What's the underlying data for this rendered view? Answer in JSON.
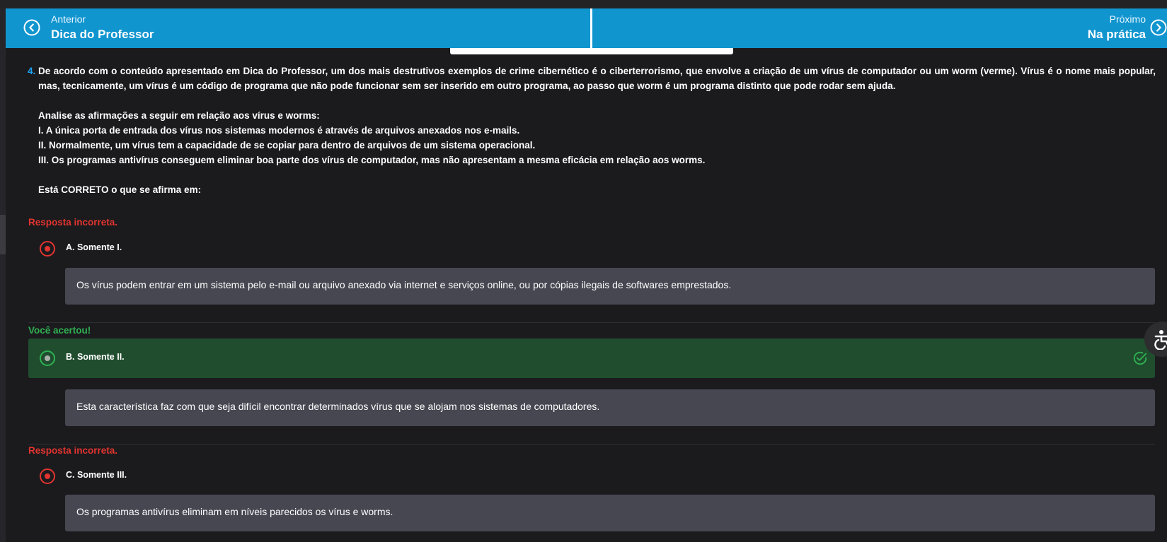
{
  "nav": {
    "prev": {
      "small": "Anterior",
      "big": "Dica do Professor"
    },
    "next": {
      "small": "Próximo",
      "big": "Na prática"
    }
  },
  "question": {
    "number": "4.",
    "paragraphs": [
      "De acordo com o conteúdo apresentado em Dica do Professor, um dos mais destrutivos exemplos de crime cibernético é o ciberterrorismo, que envolve a criação de um vírus de computador ou um worm (verme). Vírus é o nome mais popular, mas, tecnicamente, um vírus é um código de programa que não pode funcionar sem ser inserido em outro programa, ao passo que worm é um programa distinto que pode rodar sem ajuda.",
      "Analise as afirmações a seguir em relação aos vírus e worms:",
      "I. A única porta de entrada dos vírus nos sistemas modernos é através de arquivos anexados nos e-mails.",
      "II. Normalmente, um vírus tem a capacidade de se copiar para dentro de arquivos de um sistema operacional.",
      "III. Os programas antivírus conseguem eliminar boa parte dos vírus de computador, mas não apresentam a mesma eficácia em relação aos worms.",
      "Está CORRETO o que se afirma em:"
    ]
  },
  "options": [
    {
      "status": "Resposta incorreta.",
      "label": "A. Somente I.",
      "feedback": "Os vírus podem entrar em um sistema pelo e-mail ou arquivo anexado via internet e serviços online, ou por cópias ilegais de softwares emprestados."
    },
    {
      "status": "Você acertou!",
      "label": "B. Somente II.",
      "feedback": "Esta característica faz com que seja difícil encontrar determinados vírus que se alojam nos sistemas de computadores."
    },
    {
      "status": "Resposta incorreta.",
      "label": "C. Somente III.",
      "feedback": "Os programas antivírus eliminam em níveis parecidos os vírus e worms."
    }
  ],
  "colors": {
    "nav": "#1195cf",
    "incorrect": "#e3342f",
    "correct": "#2fb152",
    "correct_bg": "#1f4d2e",
    "feedback_bg": "#464751"
  },
  "icons": {
    "prev": "chevron-left-circle-icon",
    "next": "chevron-right-circle-icon",
    "correct": "check-circle-icon",
    "accessibility": "accessibility-icon"
  }
}
